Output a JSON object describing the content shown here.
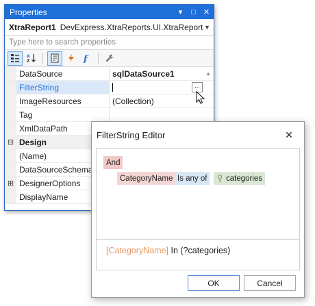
{
  "properties_panel": {
    "title": "Properties",
    "title_buttons": {
      "pin": "▾",
      "maximize": "□",
      "close": "✕"
    },
    "object_name": "XtraReport1",
    "object_type": "DevExpress.XtraReports.UI.XtraReport",
    "search_placeholder": "Type here to search properties",
    "rows": [
      {
        "name": "DataSource",
        "value": "sqlDataSource1"
      },
      {
        "name": "FilterString",
        "value": ""
      },
      {
        "name": "ImageResources",
        "value": "(Collection)"
      },
      {
        "name": "Tag",
        "value": ""
      },
      {
        "name": "XmlDataPath",
        "value": ""
      },
      {
        "name": "Design",
        "value": ""
      },
      {
        "name": "(Name)",
        "value": ""
      },
      {
        "name": "DataSourceSchema",
        "value": ""
      },
      {
        "name": "DesignerOptions",
        "value": ""
      },
      {
        "name": "DisplayName",
        "value": ""
      }
    ],
    "ellipsis_label": "...",
    "expand_minus": "⊟",
    "expand_plus": "⊞"
  },
  "dialog": {
    "title": "FilterString Editor",
    "close_glyph": "✕",
    "group_operator": "And",
    "condition": {
      "field": "CategoryName",
      "operator": "Is any of",
      "parameter": "categories"
    },
    "expression": {
      "field": "[CategoryName]",
      "rest": " In (?categories)"
    },
    "ok_label": "OK",
    "cancel_label": "Cancel"
  },
  "colors": {
    "title_bar": "#1f6fd8",
    "field_token": "#f3d6d3",
    "operator_token": "#d7e7f5",
    "parameter_token": "#d9e7d4",
    "expression_field": "#e8965f"
  }
}
